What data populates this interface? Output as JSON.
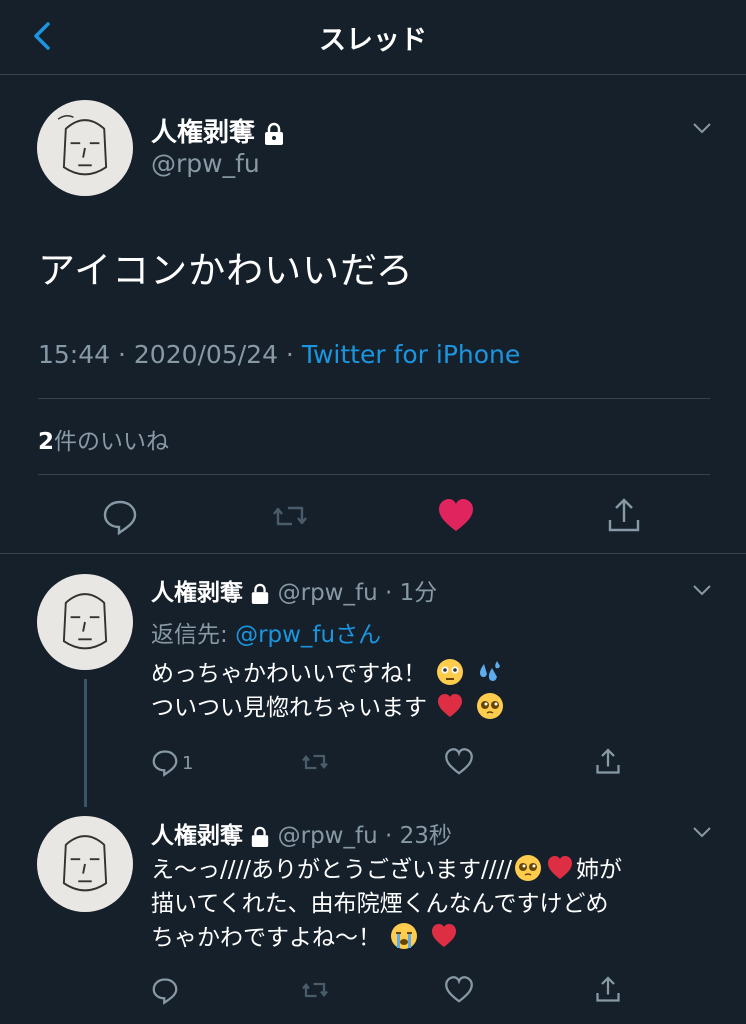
{
  "header": {
    "title": "スレッド"
  },
  "main_tweet": {
    "display_name": "人権剥奪",
    "handle": "@rpw_fu",
    "text": "アイコンかわいいだろ",
    "time": "15:44 · 2020/05/24 · ",
    "source": "Twitter for iPhone",
    "like_count": "2",
    "like_label": "件のいいね"
  },
  "replies": [
    {
      "display_name": "人権剥奪",
      "handle_time": "@rpw_fu · 1分",
      "reply_to_label": "返信先: ",
      "reply_to_handle": "@rpw_fuさん",
      "line1": "めっちゃかわいいですね！",
      "line2": "ついつい見惚れちゃいます",
      "reply_count": "1"
    },
    {
      "display_name": "人権剥奪",
      "handle_time": "@rpw_fu · 23秒",
      "line1": "え〜っ////ありがとうございます////",
      "line1_tail": "姉が",
      "line2": "描いてくれた、由布院煙くんなんですけどめ",
      "line3": "ちゃかわですよね〜！"
    }
  ],
  "colors": {
    "background": "#15202b",
    "accent": "#1b95e0",
    "like": "#e0245e",
    "muted": "#8899a6"
  }
}
